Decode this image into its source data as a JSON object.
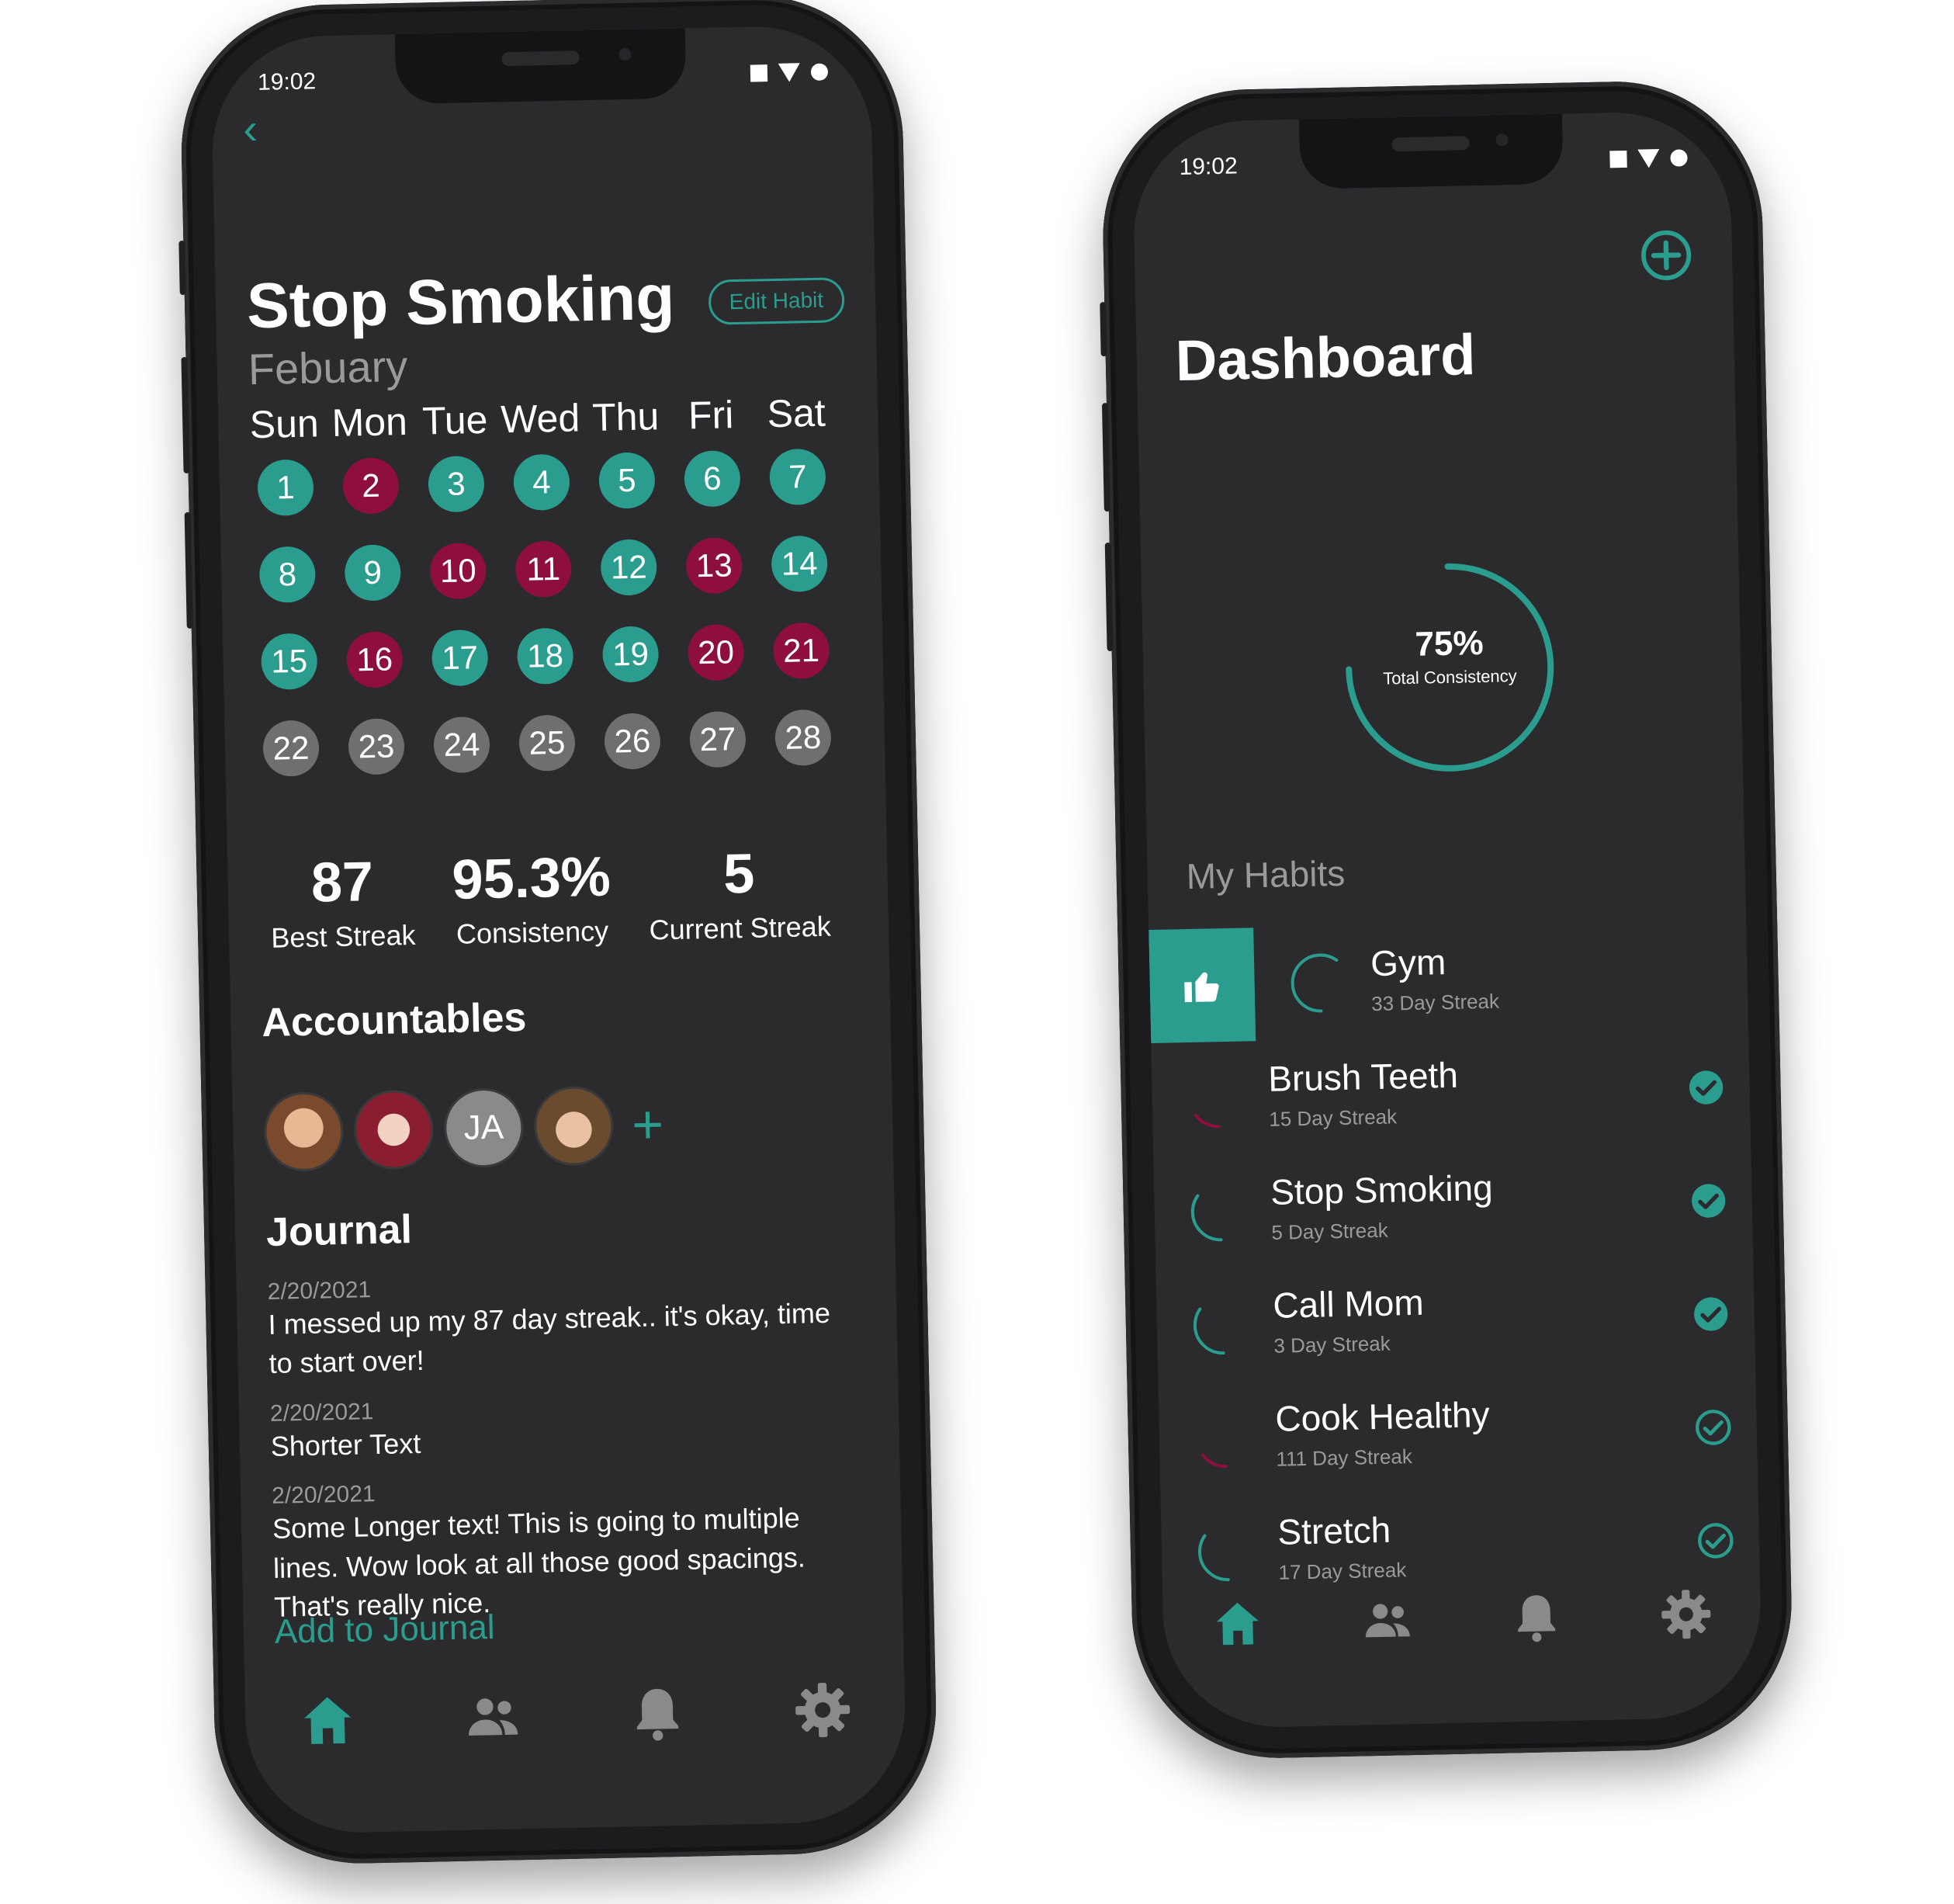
{
  "colors": {
    "accent": "#2a9d8f",
    "miss": "#8e0e3e",
    "future": "#6f6f6f",
    "screen_bg": "#2b2b2e"
  },
  "left_screen": {
    "status_time": "19:02",
    "title": "Stop Smoking",
    "edit_button": "Edit Habit",
    "month": "Febuary",
    "weekdays": [
      "Sun",
      "Mon",
      "Tue",
      "Wed",
      "Thu",
      "Fri",
      "Sat"
    ],
    "days": [
      {
        "n": "1",
        "state": "ok"
      },
      {
        "n": "2",
        "state": "miss"
      },
      {
        "n": "3",
        "state": "ok"
      },
      {
        "n": "4",
        "state": "ok"
      },
      {
        "n": "5",
        "state": "ok"
      },
      {
        "n": "6",
        "state": "ok"
      },
      {
        "n": "7",
        "state": "ok"
      },
      {
        "n": "8",
        "state": "ok"
      },
      {
        "n": "9",
        "state": "ok"
      },
      {
        "n": "10",
        "state": "miss"
      },
      {
        "n": "11",
        "state": "miss"
      },
      {
        "n": "12",
        "state": "ok"
      },
      {
        "n": "13",
        "state": "miss"
      },
      {
        "n": "14",
        "state": "ok"
      },
      {
        "n": "15",
        "state": "ok"
      },
      {
        "n": "16",
        "state": "miss"
      },
      {
        "n": "17",
        "state": "ok"
      },
      {
        "n": "18",
        "state": "ok"
      },
      {
        "n": "19",
        "state": "ok"
      },
      {
        "n": "20",
        "state": "miss"
      },
      {
        "n": "21",
        "state": "miss"
      },
      {
        "n": "22",
        "state": "future"
      },
      {
        "n": "23",
        "state": "future"
      },
      {
        "n": "24",
        "state": "future"
      },
      {
        "n": "25",
        "state": "future"
      },
      {
        "n": "26",
        "state": "future"
      },
      {
        "n": "27",
        "state": "future"
      },
      {
        "n": "28",
        "state": "future"
      }
    ],
    "stats": [
      {
        "value": "87",
        "label": "Best Streak"
      },
      {
        "value": "95.3%",
        "label": "Consistency"
      },
      {
        "value": "5",
        "label": "Current Streak"
      }
    ],
    "accountables_title": "Accountables",
    "accountable_initials": "JA",
    "journal_title": "Journal",
    "journal_entries": [
      {
        "date": "2/20/2021",
        "text": "I messed up my 87 day streak.. it's okay, time to start over!"
      },
      {
        "date": "2/20/2021",
        "text": "Shorter Text"
      },
      {
        "date": "2/20/2021",
        "text": "Some Longer text! This is going to multiple lines. Wow look at all those good spacings. That's really nice."
      }
    ],
    "add_journal": "Add to Journal"
  },
  "right_screen": {
    "status_time": "19:02",
    "title": "Dashboard",
    "consistency_value": "75%",
    "consistency_fraction": 0.75,
    "consistency_label": "Total Consistency",
    "my_habits_title": "My Habits",
    "habits": [
      {
        "name": "Gym",
        "streak": "33 Day Streak",
        "ring_color": "#2a9d8f",
        "ring_fraction": 0.6,
        "check": "none",
        "swiped": true
      },
      {
        "name": "Brush Teeth",
        "streak": "15 Day Streak",
        "ring_color": "#8e0e3e",
        "ring_fraction": 0.15,
        "check": "filled",
        "swiped": false
      },
      {
        "name": "Stop Smoking",
        "streak": "5 Day Streak",
        "ring_color": "#2a9d8f",
        "ring_fraction": 0.35,
        "check": "filled",
        "swiped": false
      },
      {
        "name": "Call Mom",
        "streak": "3 Day Streak",
        "ring_color": "#2a9d8f",
        "ring_fraction": 0.35,
        "check": "filled",
        "swiped": false
      },
      {
        "name": "Cook Healthy",
        "streak": "111 Day Streak",
        "ring_color": "#8e0e3e",
        "ring_fraction": 0.15,
        "check": "outline",
        "swiped": false
      },
      {
        "name": "Stretch",
        "streak": "17 Day Streak",
        "ring_color": "#2a9d8f",
        "ring_fraction": 0.35,
        "check": "outline",
        "swiped": false
      }
    ]
  },
  "nav_icons": [
    "home-icon",
    "people-icon",
    "bell-icon",
    "gear-icon"
  ]
}
